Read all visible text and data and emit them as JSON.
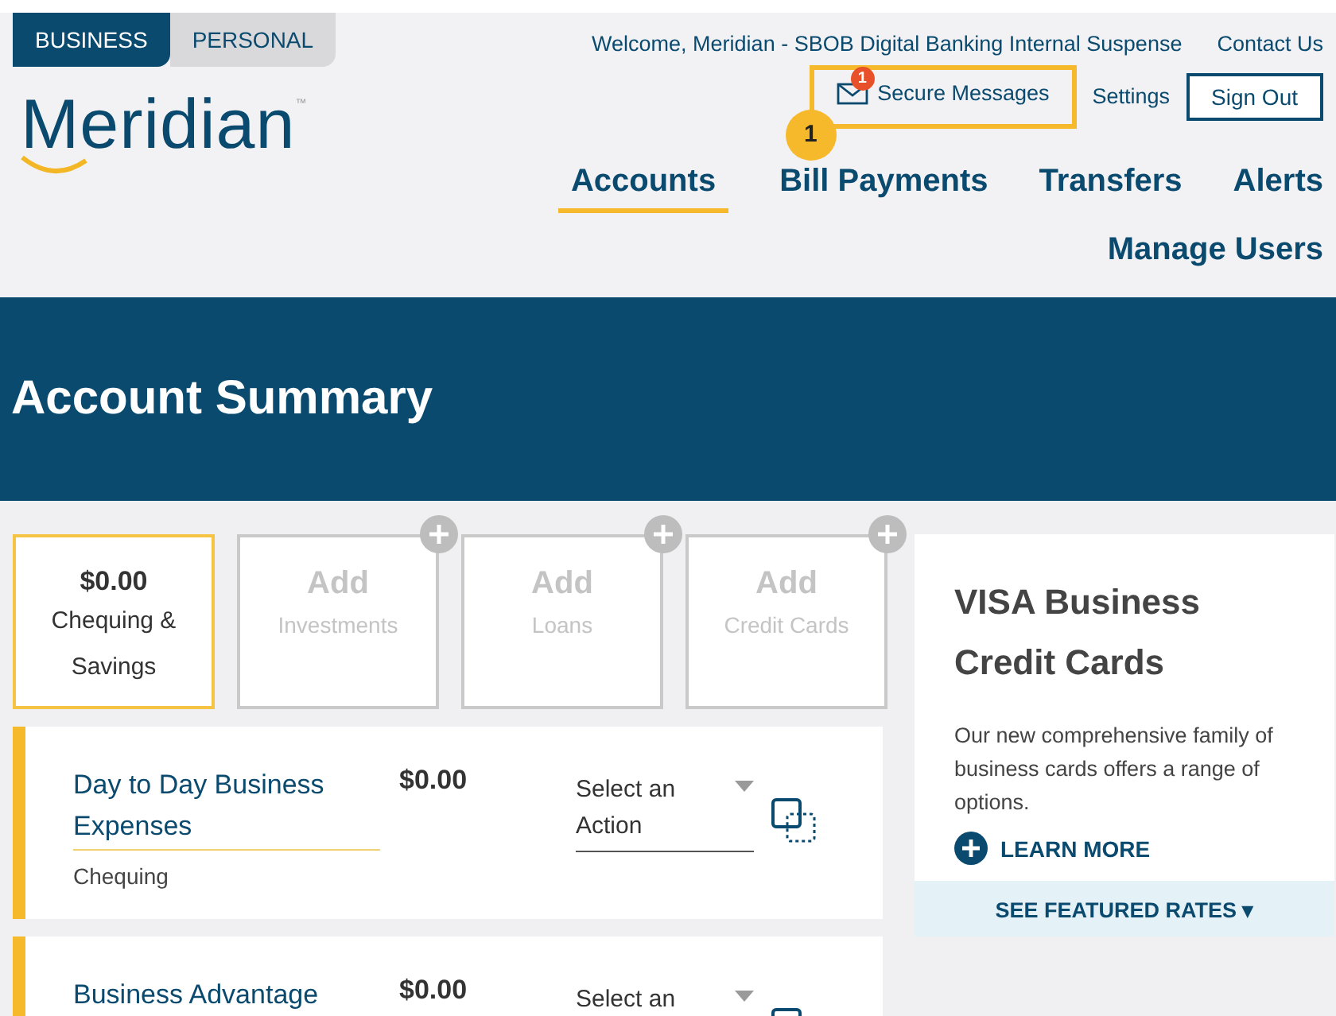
{
  "account_type_tabs": [
    {
      "label": "BUSINESS",
      "selected": true
    },
    {
      "label": "PERSONAL",
      "selected": false
    }
  ],
  "logo": {
    "text": "Meridian",
    "trademark": "™"
  },
  "header": {
    "welcome": "Welcome, Meridian - SBOB Digital Banking Internal Suspense",
    "contact": "Contact Us",
    "secure_messages": {
      "label": "Secure Messages",
      "badge": "1",
      "highlighted": true,
      "callout": "1"
    },
    "settings": "Settings",
    "sign_out": "Sign Out"
  },
  "nav": [
    {
      "label": "Accounts",
      "selected": true
    },
    {
      "label": "Bill Payments",
      "selected": false
    },
    {
      "label": "Transfers",
      "selected": false
    },
    {
      "label": "Alerts",
      "selected": false
    },
    {
      "label": "Manage Users",
      "selected": false
    }
  ],
  "banner_title": "Account Summary",
  "summary_tiles": [
    {
      "kind": "total",
      "amount": "$0.00",
      "label": "Chequing & Savings",
      "selected": true
    },
    {
      "kind": "add",
      "action": "Add",
      "label": "Investments",
      "selected": false
    },
    {
      "kind": "add",
      "action": "Add",
      "label": "Loans",
      "selected": false
    },
    {
      "kind": "add",
      "action": "Add",
      "label": "Credit Cards",
      "selected": false
    }
  ],
  "accounts": [
    {
      "name": "Day to Day Business Expenses",
      "balance": "$0.00",
      "type": "Chequing",
      "action_placeholder": "Select an Action"
    },
    {
      "name": "Business Advantage",
      "balance": "$0.00",
      "action_placeholder": "Select an"
    }
  ],
  "promo": {
    "title": "VISA Business Credit Cards",
    "text": "Our new comprehensive family of business cards offers a range of options.",
    "link": "LEARN MORE",
    "rates": "SEE FEATURED RATES",
    "rates_caret": "▾"
  }
}
